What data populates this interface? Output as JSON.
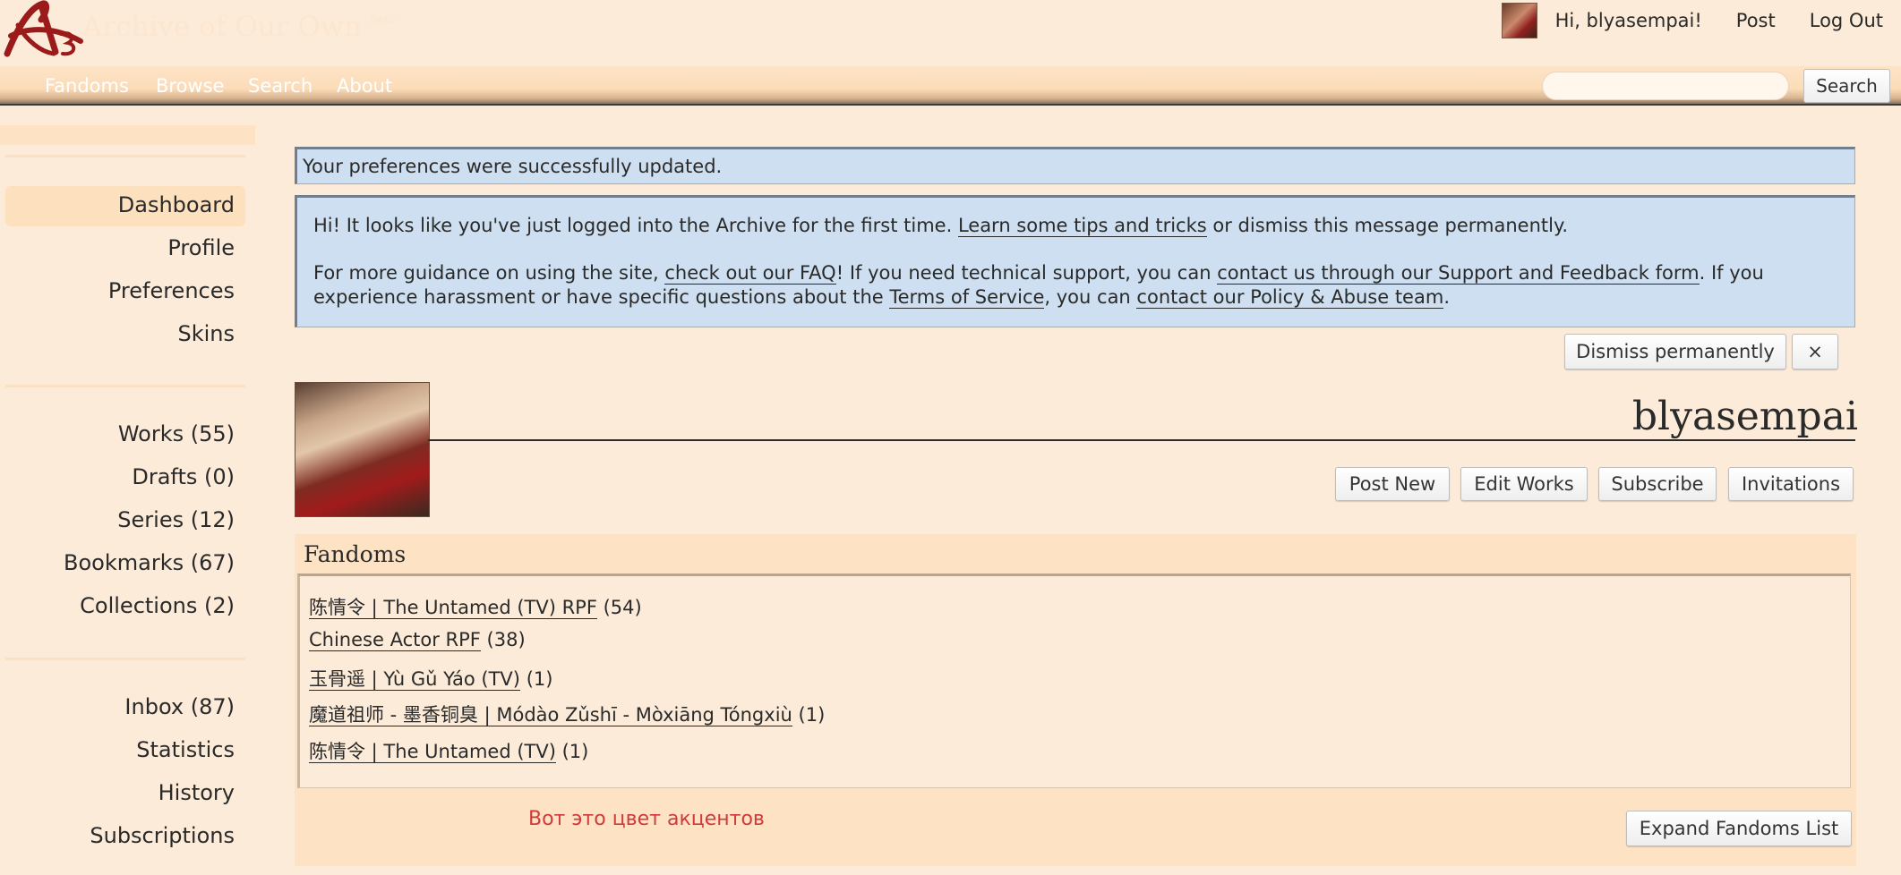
{
  "header": {
    "site_title": "Archive of Our Own",
    "site_beta": "beta",
    "greeting": "Hi, blyasempai!",
    "post": "Post",
    "logout": "Log Out"
  },
  "primary_nav": [
    "Fandoms",
    "Browse",
    "Search",
    "About"
  ],
  "search": {
    "placeholder": "",
    "button": "Search"
  },
  "sidebar": {
    "group1": [
      "Dashboard",
      "Profile",
      "Preferences",
      "Skins"
    ],
    "group2": [
      "Works (55)",
      "Drafts (0)",
      "Series (12)",
      "Bookmarks (67)",
      "Collections (2)"
    ],
    "group3": [
      "Inbox (87)",
      "Statistics",
      "History",
      "Subscriptions"
    ]
  },
  "flash_notice": "Your preferences were successfully updated.",
  "welcome": {
    "p1_a": "Hi! It looks like you've just logged into the Archive for the first time. ",
    "p1_link": "Learn some tips and tricks",
    "p1_b": " or dismiss this message permanently.",
    "p2_a": "For more guidance on using the site, ",
    "p2_link1": "check out our FAQ",
    "p2_b": "! If you need technical support, you can ",
    "p2_link2": "contact us through our Support and Feedback form",
    "p2_c": ". If you experience harassment or have specific questions about the ",
    "p2_link3": "Terms of Service",
    "p2_d": ", you can ",
    "p2_link4": "contact our Policy & Abuse team",
    "p2_e": ".",
    "dismiss": "Dismiss permanently",
    "close": "×"
  },
  "profile": {
    "username": "blyasempai",
    "actions": [
      "Post New",
      "Edit Works",
      "Subscribe",
      "Invitations"
    ]
  },
  "fandoms": {
    "heading": "Fandoms",
    "items": [
      {
        "name": "陈情令 | The Untamed (TV) RPF",
        "count": "(54)"
      },
      {
        "name": "Chinese Actor RPF",
        "count": "(38)"
      },
      {
        "name": "玉骨遥 | Yù Gǔ Yáo (TV)",
        "count": "(1)"
      },
      {
        "name": "魔道祖师 - 墨香铜臭 | Módào Zǔshī - Mòxiāng Tóngxiù",
        "count": "(1)"
      },
      {
        "name": "陈情令 | The Untamed (TV)",
        "count": "(1)"
      }
    ],
    "accent_note": "Вот это цвет акцентов",
    "expand": "Expand Fandoms List"
  },
  "colors": {
    "background": "#fbebd8",
    "accent": "#d13a3a",
    "notice": "#cddff0"
  }
}
